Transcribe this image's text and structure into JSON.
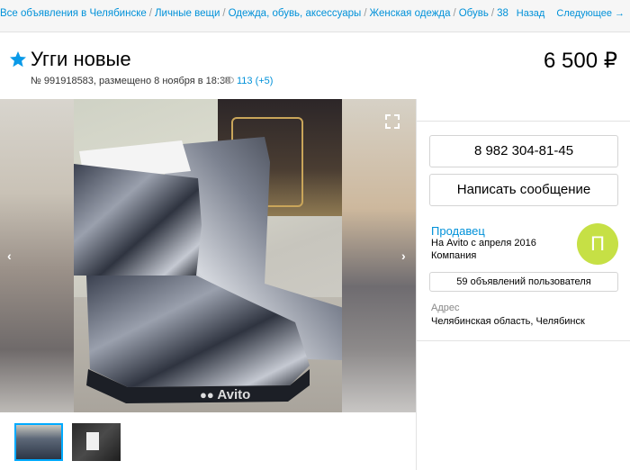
{
  "breadcrumbs": [
    "Все объявления в Челябинске",
    "Личные вещи",
    "Одежда, обувь, аксессуары",
    "Женская одежда",
    "Обувь",
    "38"
  ],
  "topnav": {
    "back": "Назад",
    "next": "Следующее →"
  },
  "listing": {
    "title": "Угги новые",
    "meta": "№ 991918583, размещено 8 ноября в 18:30",
    "views": "113 (+5)",
    "price": "6 500 ₽"
  },
  "gallery": {
    "watermark": "Avito",
    "prev": "‹",
    "next": "›"
  },
  "contact": {
    "phone": "8 982 304-81-45",
    "message_button": "Написать сообщение"
  },
  "seller": {
    "heading": "Продавец",
    "since": "На Avito с апреля 2016",
    "type": "Компания",
    "avatar_letter": "П",
    "listings_button": "59 объявлений пользователя"
  },
  "address": {
    "heading": "Адрес",
    "value": "Челябинская область, Челябинск"
  },
  "colors": {
    "link": "#0091d9",
    "avatar": "#c6e045",
    "star": "#0a9ae8"
  }
}
